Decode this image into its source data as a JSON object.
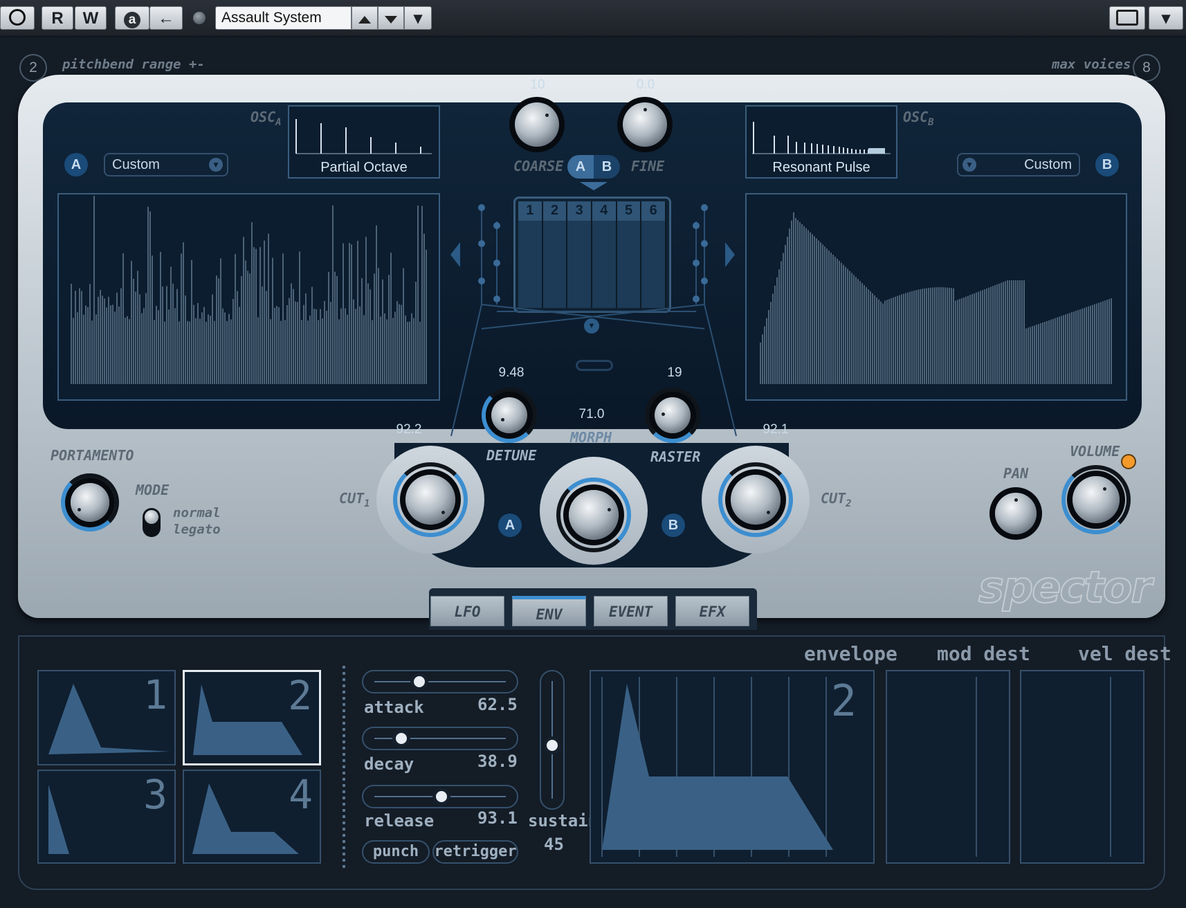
{
  "toolbar": {
    "power_icon": "power-icon",
    "read_label": "R",
    "write_label": "W",
    "auto_label": "a",
    "back_label": "←",
    "preset_name": "Assault System",
    "camera_icon": "camera-icon",
    "dropdown_glyph": "▾"
  },
  "header": {
    "pitchbend_value": "2",
    "pitchbend_label": "pitchbend range +-",
    "maxvoices_value": "8",
    "maxvoices_label": "max voices"
  },
  "osc_a": {
    "badge": "A",
    "label": "OSC",
    "sub": "A",
    "preset": "Custom",
    "waveform": "Partial Octave"
  },
  "osc_b": {
    "badge": "B",
    "label": "OSC",
    "sub": "B",
    "preset": "Custom",
    "waveform": "Resonant Pulse"
  },
  "tuning": {
    "coarse_value": "10",
    "coarse_label": "COARSE",
    "fine_value": "0.0",
    "fine_label": "FINE",
    "ab_a": "A",
    "ab_b": "B"
  },
  "morph_slots": [
    "1",
    "2",
    "3",
    "4",
    "5",
    "6"
  ],
  "controls": {
    "detune_value": "9.48",
    "detune_label": "DETUNE",
    "morph_value": "71.0",
    "morph_label": "MORPH",
    "raster_value": "19",
    "raster_label": "RASTER",
    "cut1_value": "92.2",
    "cut1_label": "CUT",
    "cut1_sub": "1",
    "cut2_value": "92.1",
    "cut2_label": "CUT",
    "cut2_sub": "2",
    "badge_a": "A",
    "badge_b": "B",
    "portamento_label": "PORTAMENTO",
    "mode_label": "MODE",
    "mode_normal": "normal",
    "mode_legato": "legato",
    "pan_label": "PAN",
    "volume_label": "VOLUME"
  },
  "brand": "spector",
  "tabs": [
    "LFO",
    "ENV",
    "EVENT",
    "EFX"
  ],
  "active_tab": "ENV",
  "envelope": {
    "slots": [
      "1",
      "2",
      "3",
      "4"
    ],
    "selected": "2",
    "attack_label": "attack",
    "attack_value": "62.5",
    "decay_label": "decay",
    "decay_value": "38.9",
    "release_label": "release",
    "release_value": "93.1",
    "sustain_label": "sustain",
    "sustain_value": "45",
    "punch_label": "punch",
    "retrigger_label": "retrigger",
    "envelope_header": "envelope",
    "moddest_header": "mod dest",
    "veldest_header": "vel dest",
    "display_number": "2"
  },
  "colors": {
    "accent_blue": "#3c8ed0",
    "panel_dark": "#0b1d2f",
    "volume_led": "#f39a2a"
  }
}
